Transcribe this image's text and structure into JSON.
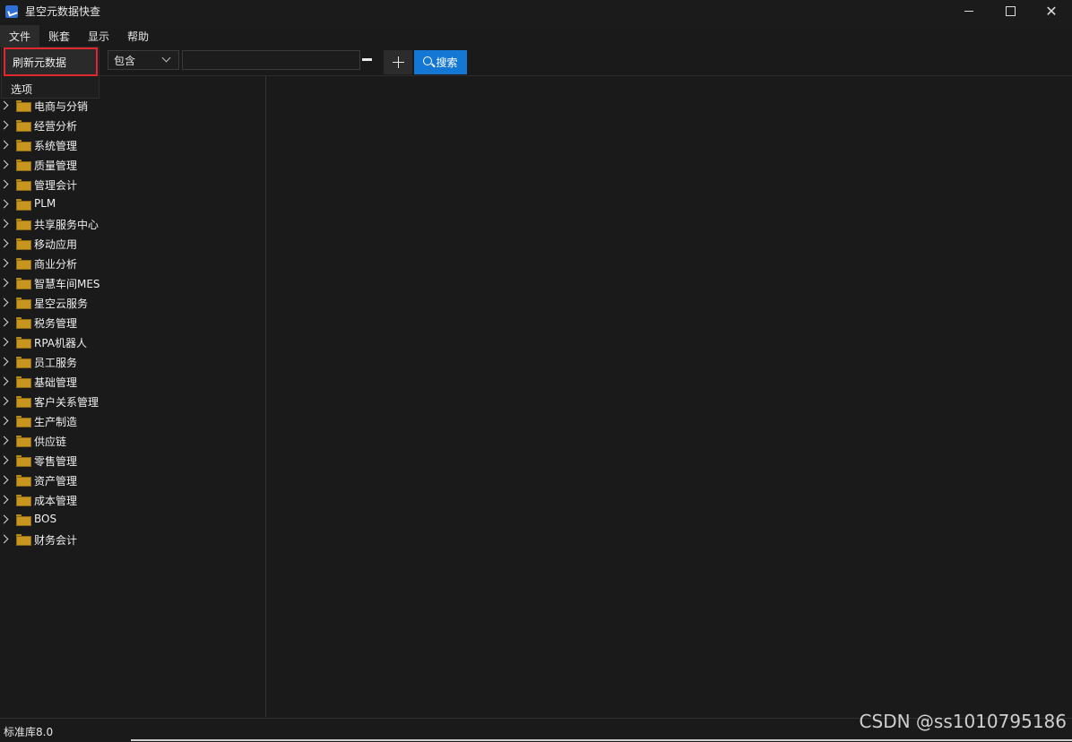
{
  "window": {
    "title": "星空元数据快查"
  },
  "menubar": {
    "items": [
      "文件",
      "账套",
      "显示",
      "帮助"
    ]
  },
  "dropdown": {
    "items": [
      "刷新元数据",
      "选项"
    ]
  },
  "toolbar": {
    "filter_select": "包含",
    "search_value": "",
    "search_button": "搜索"
  },
  "tree": {
    "items": [
      "电商与分销",
      "经营分析",
      "系统管理",
      "质量管理",
      "管理会计",
      "PLM",
      "共享服务中心",
      "移动应用",
      "商业分析",
      "智慧车间MES",
      "星空云服务",
      "税务管理",
      "RPA机器人",
      "员工服务",
      "基础管理",
      "客户关系管理",
      "生产制造",
      "供应链",
      "零售管理",
      "资产管理",
      "成本管理",
      "BOS",
      "财务会计"
    ]
  },
  "statusbar": {
    "text": "标准库8.0"
  },
  "watermark": "CSDN @ss1010795186",
  "colors": {
    "accent": "#1577d4",
    "highlight_border": "#e0272d",
    "folder": "#c8961f"
  }
}
